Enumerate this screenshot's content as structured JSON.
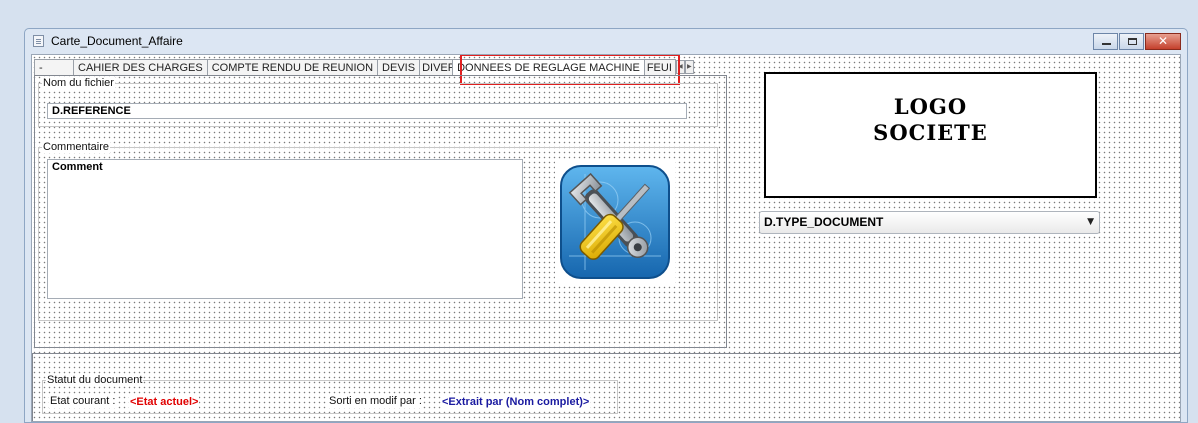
{
  "window": {
    "title": "Carte_Document_Affaire",
    "close_glyph": "✕"
  },
  "tabs": {
    "items": [
      {
        "label": "-"
      },
      {
        "label": "CAHIER DES CHARGES"
      },
      {
        "label": "COMPTE RENDU DE REUNION"
      },
      {
        "label": "DEVIS"
      },
      {
        "label": "DIVERS"
      },
      {
        "label": "DONNEES DE REGLAGE MACHINE"
      },
      {
        "label": "FEUI"
      }
    ],
    "active_index": 5,
    "scroll_left": "◀",
    "scroll_right": "▶"
  },
  "file_group": {
    "label": "Nom du fichier",
    "value": "D.REFERENCE"
  },
  "comment_group": {
    "label": "Commentaire",
    "value": "Comment"
  },
  "logo": {
    "line1": "LOGO",
    "line2": "SOCIETE"
  },
  "doc_type": {
    "value": "D.TYPE_DOCUMENT",
    "arrow": "▼"
  },
  "status_group": {
    "label": "Statut du document",
    "current_label": "Etat courant :",
    "current_value": "<Etat actuel>",
    "checkout_label": "Sorti en modif par :",
    "checkout_value": "<Extrait par (Nom complet)>"
  },
  "icons": {
    "tool_image": "wrench-screwdriver-icon"
  },
  "colors": {
    "highlight": "#e02020",
    "status_red": "#e00000",
    "status_blue": "#1a1aa0",
    "tool_bg": "#2a86c8"
  }
}
